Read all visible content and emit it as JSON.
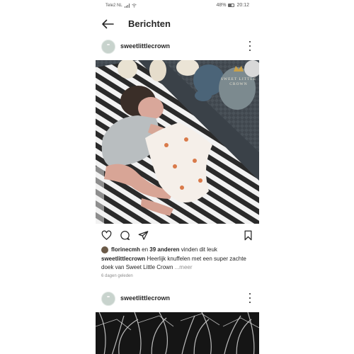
{
  "status_bar": {
    "carrier": "Tele2 NL",
    "battery": "48%",
    "time": "20:12"
  },
  "header": {
    "title": "Berichten",
    "back_icon": "arrow-left-icon"
  },
  "posts": [
    {
      "username": "sweetlittlecrown",
      "image_watermark": [
        "SWEET LITTLE",
        "CROWN"
      ],
      "liked_by_user": "florinecmh",
      "likes_connector": "en",
      "likes_others": "39 anderen",
      "likes_suffix": "vinden dit leuk",
      "caption_user": "sweetlittlecrown",
      "caption_text": "Heerlijk knuffelen met een super zachte doek van Sweet Little Crown",
      "caption_more": "...meer",
      "timestamp": "6 dagen geleden"
    },
    {
      "username": "sweetlittlecrown"
    }
  ],
  "icons": {
    "like": "heart-icon",
    "comment": "comment-icon",
    "share": "paper-plane-icon",
    "save": "bookmark-icon",
    "more": "more-vertical-icon"
  },
  "colors": {
    "text": "#262626",
    "muted": "#8e8e8e",
    "background": "#ffffff"
  }
}
